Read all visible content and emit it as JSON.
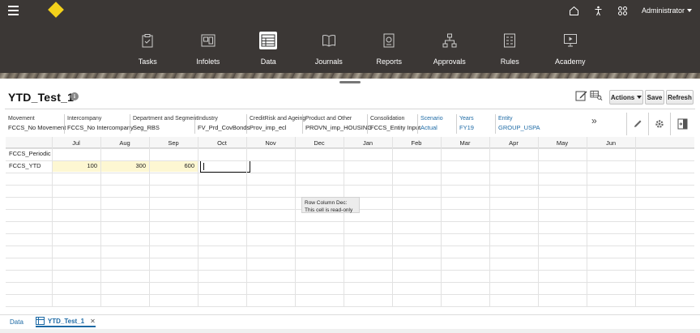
{
  "header": {
    "user_label": "Administrator",
    "icons": [
      "home-icon",
      "accessibility-icon",
      "navigator-icon"
    ]
  },
  "nav": {
    "items": [
      {
        "label": "Tasks",
        "icon": "clipboard-icon"
      },
      {
        "label": "Infolets",
        "icon": "infolets-icon"
      },
      {
        "label": "Data",
        "icon": "data-grid-icon",
        "active": true
      },
      {
        "label": "Journals",
        "icon": "book-icon"
      },
      {
        "label": "Reports",
        "icon": "report-icon"
      },
      {
        "label": "Approvals",
        "icon": "hierarchy-icon"
      },
      {
        "label": "Rules",
        "icon": "rules-icon"
      },
      {
        "label": "Academy",
        "icon": "academy-icon"
      }
    ]
  },
  "form": {
    "title": "YTD_Test_1",
    "actions_label": "Actions",
    "save_label": "Save",
    "refresh_label": "Refresh"
  },
  "pov": [
    {
      "name": "Movement",
      "value": "FCCS_No Movement",
      "page": false
    },
    {
      "name": "Intercompany",
      "value": "FCCS_No Intercompany",
      "page": false
    },
    {
      "name": "Department and Segment",
      "value": "Seg_RBS",
      "page": false
    },
    {
      "name": "Industry",
      "value": "FV_Prd_CovBonds",
      "page": false
    },
    {
      "name": "CreditRisk and Ageing",
      "value": "Prov_imp_ecl",
      "page": false
    },
    {
      "name": "Product and Other",
      "value": "PROVN_imp_HOUSING",
      "page": false
    },
    {
      "name": "Consolidation",
      "value": "FCCS_Entity Input",
      "page": false
    },
    {
      "name": "Scenario",
      "value": "Actual",
      "page": true
    },
    {
      "name": "Years",
      "value": "FY19",
      "page": true
    },
    {
      "name": "Entity",
      "value": "GROUP_USPA",
      "page": true
    }
  ],
  "grid": {
    "columns": [
      "Jul",
      "Aug",
      "Sep",
      "Oct",
      "Nov",
      "Dec",
      "Jan",
      "Feb",
      "Mar",
      "Apr",
      "May",
      "Jun"
    ],
    "rows": [
      {
        "label": "FCCS_Periodic",
        "values": [
          "",
          "",
          "",
          "",
          "",
          "",
          "",
          "",
          "",
          "",
          "",
          ""
        ]
      },
      {
        "label": "FCCS_YTD",
        "values": [
          "100",
          "300",
          "600",
          "",
          "",
          "",
          "",
          "",
          "",
          "",
          "",
          ""
        ]
      }
    ]
  },
  "tooltip": {
    "line1": "Row  Column Dec:",
    "line2": "This cell is read-only"
  },
  "bottom_tabs": {
    "data_label": "Data",
    "form_label": "YTD_Test_1"
  }
}
